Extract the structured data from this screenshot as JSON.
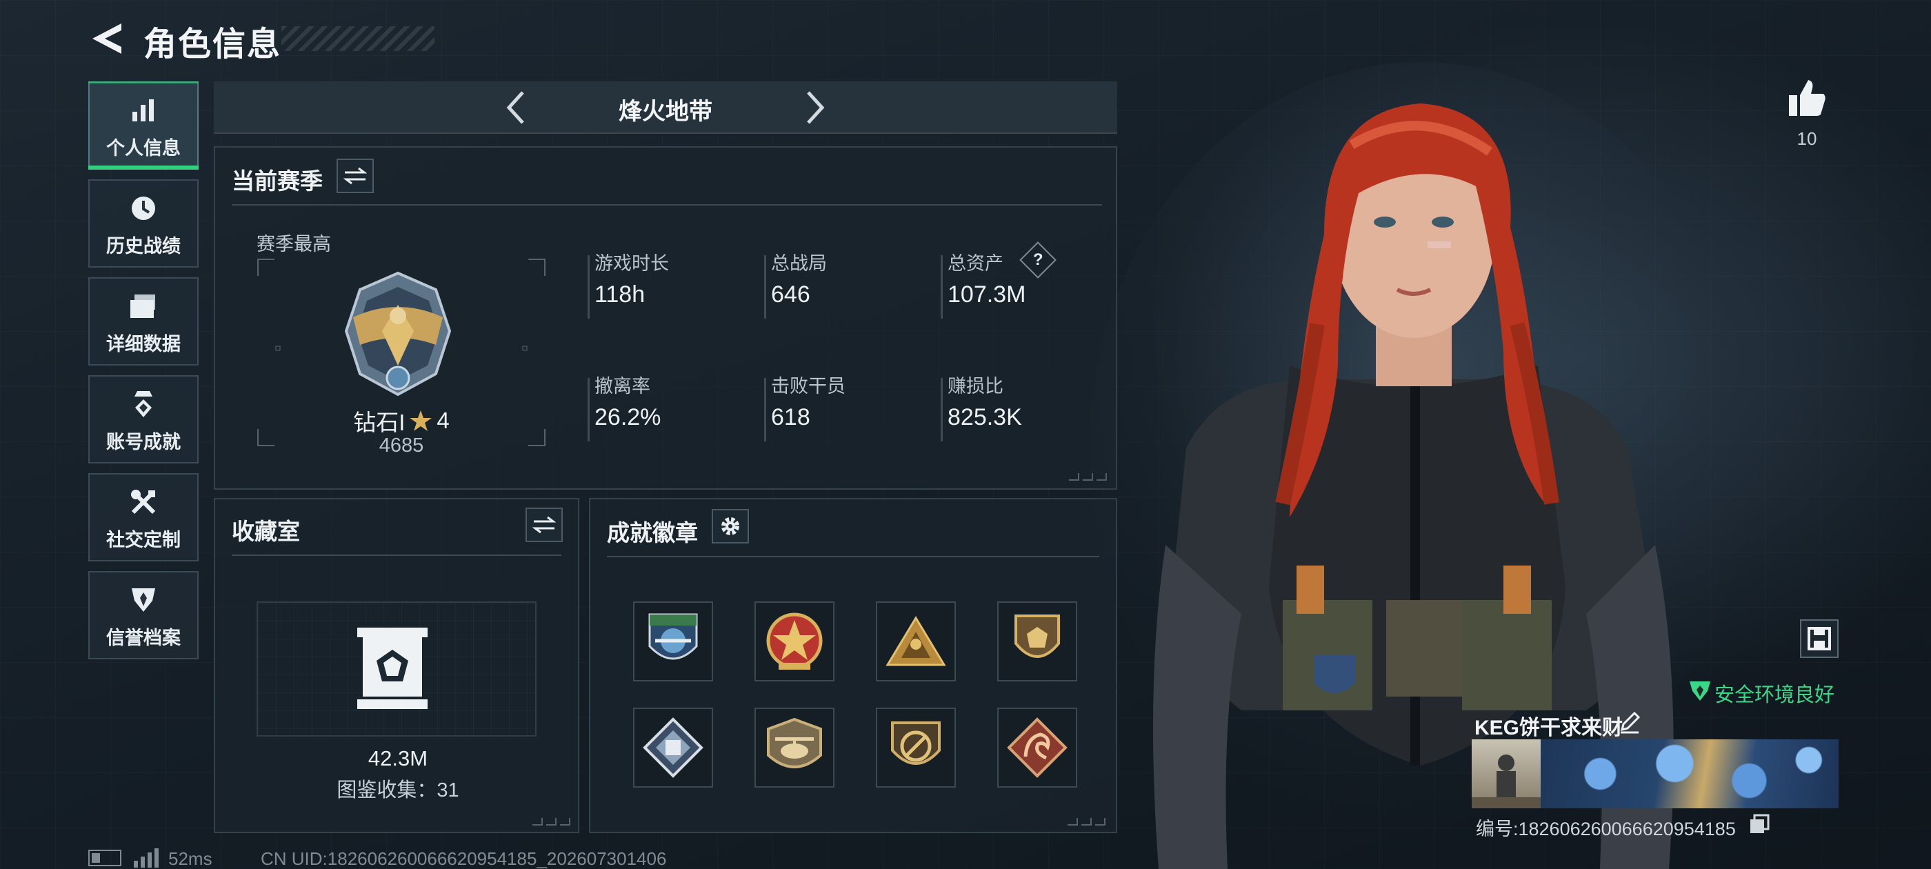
{
  "header": {
    "title": "角色信息"
  },
  "nav": {
    "items": [
      {
        "label": "个人信息",
        "icon": "bar-chart-icon",
        "active": true
      },
      {
        "label": "历史战绩",
        "icon": "history-clock-icon",
        "active": false
      },
      {
        "label": "详细数据",
        "icon": "folder-icon",
        "active": false
      },
      {
        "label": "账号成就",
        "icon": "medal-icon",
        "active": false
      },
      {
        "label": "社交定制",
        "icon": "tools-icon",
        "active": false
      },
      {
        "label": "信誉档案",
        "icon": "shield-icon",
        "active": false
      }
    ]
  },
  "mode": {
    "name": "烽火地带"
  },
  "season": {
    "title": "当前赛季",
    "best_label": "赛季最高",
    "rank_name": "钻石I",
    "rank_stars": "4",
    "rank_points": "4685",
    "stats": [
      {
        "label": "游戏时长",
        "value": "118h"
      },
      {
        "label": "总战局",
        "value": "646"
      },
      {
        "label": "总资产",
        "value": "107.3M",
        "help": "?"
      },
      {
        "label": "撤离率",
        "value": "26.2%"
      },
      {
        "label": "击败干员",
        "value": "618"
      },
      {
        "label": "赚损比",
        "value": "825.3K"
      }
    ]
  },
  "collection": {
    "title": "收藏室",
    "value": "42.3M",
    "catalog_label": "图鉴收集：31"
  },
  "achievements": {
    "title": "成就徽章",
    "badges": [
      {
        "icon": "blue-wing-badge-icon"
      },
      {
        "icon": "red-star-badge-icon"
      },
      {
        "icon": "gold-triangle-badge-icon"
      },
      {
        "icon": "gold-shield-badge-icon"
      },
      {
        "icon": "silver-diamond-badge-icon"
      },
      {
        "icon": "helicopter-badge-icon"
      },
      {
        "icon": "gold-circle-badge-icon"
      },
      {
        "icon": "dragon-badge-icon"
      }
    ]
  },
  "profile": {
    "likes": "10",
    "safety_status": "安全环境良好",
    "player_name": "KEG饼干求来财",
    "player_id": "编号:18260626006662095418​5"
  },
  "status_bar": {
    "ping": "52ms",
    "uid": "CN UID:18260626006662095418​5_202607301406"
  },
  "colors": {
    "accent_green": "#35d07f",
    "safe_green": "#39d888",
    "hair_red": "#c23a22"
  }
}
